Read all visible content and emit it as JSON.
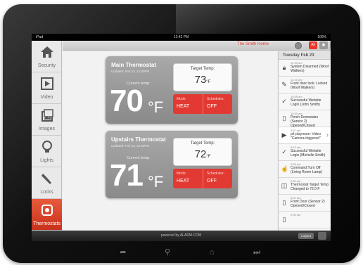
{
  "status_bar": {
    "device": "iPad",
    "time": "12:42 PM",
    "battery": "100%"
  },
  "sidebar": {
    "items": [
      {
        "label": "Security",
        "icon": "house-icon"
      },
      {
        "label": "Video",
        "icon": "play-icon"
      },
      {
        "label": "Images",
        "icon": "images-icon"
      },
      {
        "label": "Lights",
        "icon": "lightbulb-icon"
      },
      {
        "label": "Locks",
        "icon": "wrench-icon"
      },
      {
        "label": "Thermostats",
        "icon": "thermostat-icon"
      }
    ],
    "active": "Thermostats"
  },
  "topbar": {
    "home_name": "The Smith Home",
    "filter_all": "All"
  },
  "thermostats": [
    {
      "title": "Main Thermostat",
      "updated": "Updated: Feb 23, 12:40PM",
      "current_label": "Current temp:",
      "current_value": "70",
      "unit": "°F",
      "target_label": "Target Temp:",
      "target_value": "73",
      "target_unit": "°F",
      "mode_label": "Mode:",
      "mode_value": "HEAT",
      "schedules_label": "Schedules:",
      "schedules_value": "OFF"
    },
    {
      "title": "Upstairs Thermostat",
      "updated": "Updated: Feb 23, 12:40PM",
      "current_label": "Current temp:",
      "current_value": "71",
      "unit": "°F",
      "target_label": "Target Temp:",
      "target_value": "72",
      "target_unit": "°F",
      "mode_label": "Mode:",
      "mode_value": "HEAT",
      "schedules_label": "Schedules:",
      "schedules_value": "OFF"
    }
  ],
  "events": {
    "date": "Tuesday Feb 23",
    "items": [
      {
        "time": "12:30 am",
        "text": "System Disarmed (Woof Walkers)",
        "icon": "lock-icon"
      },
      {
        "time": "12:30 am",
        "text": "Front door lock: Locked (Woof Walkers)",
        "icon": "wrench-icon"
      },
      {
        "time": "10:45 am",
        "text": "Successful Website Login (John Smith)",
        "icon": "checkmark-icon"
      },
      {
        "time": "10:30 am",
        "text": "Porch Downstairs (Sensor 2) Opened/Closed",
        "icon": "door-sensor-icon"
      },
      {
        "time": "9:57 am",
        "text": "p/t playroom: Video \"Camera-triggered\"",
        "icon": "video-icon"
      },
      {
        "time": "9:42 am",
        "text": "Successful Website Login (Michelle Smith)",
        "icon": "checkmark-icon"
      },
      {
        "time": "9:35 am",
        "text": "Command:Turn Off (Living Room Lamp)",
        "icon": "hand-icon"
      },
      {
        "time": "9:30 am",
        "text": "Thermostat Target Temp Changed to 72.0 F",
        "icon": "thermostat-icon"
      },
      {
        "time": "9:20 am",
        "text": "Front Door (Sensor 2) Opened/Closed",
        "icon": "door-sensor-icon"
      },
      {
        "time": "9:05 am",
        "text": "",
        "icon": "door-sensor-icon"
      }
    ]
  },
  "footer": {
    "powered": "powered by ALARM.COM",
    "logout": "Logout"
  }
}
